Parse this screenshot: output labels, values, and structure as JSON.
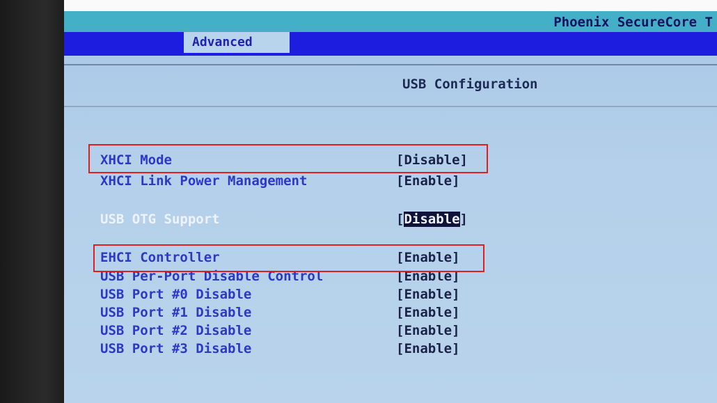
{
  "bios": {
    "title": "Phoenix SecureCore T",
    "tab_active": "Advanced",
    "section_title": "USB Configuration"
  },
  "settings": [
    {
      "label": "XHCI Mode",
      "value": "[Disable]"
    },
    {
      "label": "XHCI Link Power Management",
      "value": "[Enable]"
    },
    {
      "label": "USB OTG Support",
      "value_open": "[",
      "value_hl": "Disable",
      "value_close": "]"
    },
    {
      "label": "EHCI Controller",
      "value": "[Enable]"
    },
    {
      "label": "USB Per-Port Disable Control",
      "value": "[Enable]"
    },
    {
      "label": "USB Port #0 Disable",
      "value": "[Enable]"
    },
    {
      "label": "USB Port #1 Disable",
      "value": "[Enable]"
    },
    {
      "label": "USB Port #2 Disable",
      "value": "[Enable]"
    },
    {
      "label": "USB Port #3 Disable",
      "value": "[Enable]"
    }
  ],
  "colors": {
    "screen_bg": "#b4d0ea",
    "tab_bar": "#1d1de0",
    "title_bar": "#44b0c8",
    "label_text": "#2c38c6",
    "highlight_box": "#e01e1e"
  }
}
